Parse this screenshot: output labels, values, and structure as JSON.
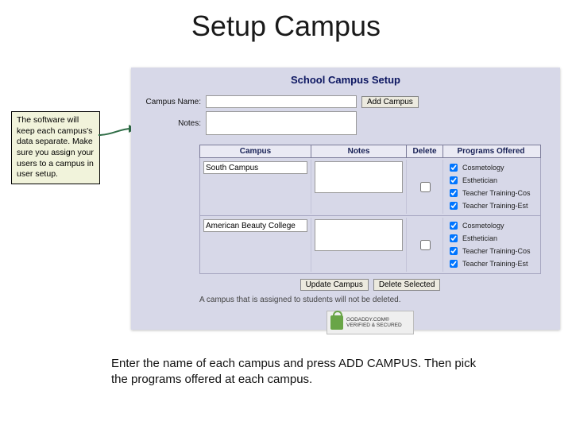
{
  "title": "Setup Campus",
  "callout": "The software will keep each campus's data separate. Make sure you assign your users to a campus in user setup.",
  "panel": {
    "heading": "School Campus Setup",
    "campus_name_label": "Campus Name:",
    "notes_label": "Notes:",
    "add_btn": "Add Campus",
    "headers": {
      "campus": "Campus",
      "notes": "Notes",
      "delete": "Delete",
      "programs": "Programs Offered"
    },
    "rows": [
      {
        "campus": "South Campus",
        "programs": [
          "Cosmetology",
          "Esthetician",
          "Teacher Training-Cos",
          "Teacher Training-Est"
        ]
      },
      {
        "campus": "American Beauty College",
        "programs": [
          "Cosmetology",
          "Esthetician",
          "Teacher Training-Cos",
          "Teacher Training-Est"
        ]
      }
    ],
    "update_btn": "Update Campus",
    "delete_btn": "Delete Selected",
    "disclaimer": "A campus that is assigned to students will not be deleted.",
    "seal_top": "GODADDY.COM®",
    "seal_bottom": "VERIFIED & SECURED"
  },
  "instructions": "Enter the name of each campus and press ADD CAMPUS. Then pick the programs offered at each campus."
}
